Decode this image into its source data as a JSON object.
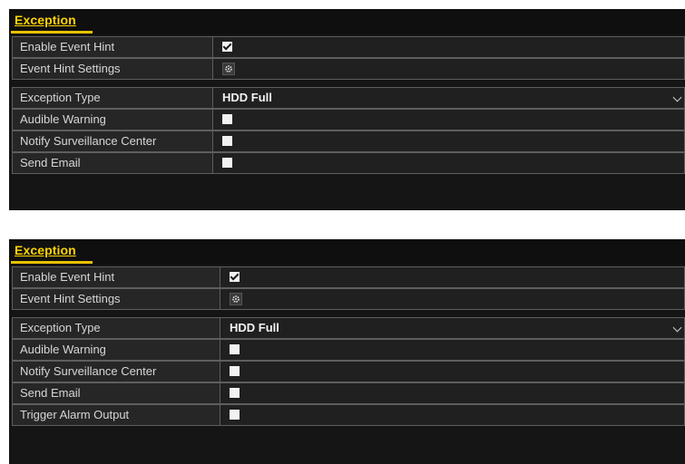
{
  "section": {
    "title": "Exception"
  },
  "panels": [
    {
      "rows_group1": [
        {
          "label": "Enable Event Hint",
          "type": "checkbox",
          "checked": true
        },
        {
          "label": "Event Hint Settings",
          "type": "gear"
        }
      ],
      "rows_group2": [
        {
          "label": "Exception Type",
          "type": "select",
          "value": "HDD Full"
        },
        {
          "label": "Audible Warning",
          "type": "checkbox",
          "checked": false
        },
        {
          "label": "Notify Surveillance Center",
          "type": "checkbox",
          "checked": false
        },
        {
          "label": "Send Email",
          "type": "checkbox",
          "checked": false
        }
      ]
    },
    {
      "rows_group1": [
        {
          "label": "Enable Event Hint",
          "type": "checkbox",
          "checked": true
        },
        {
          "label": "Event Hint Settings",
          "type": "gear"
        }
      ],
      "rows_group2": [
        {
          "label": "Exception Type",
          "type": "select",
          "value": "HDD Full"
        },
        {
          "label": "Audible Warning",
          "type": "checkbox",
          "checked": false
        },
        {
          "label": "Notify Surveillance Center",
          "type": "checkbox",
          "checked": false
        },
        {
          "label": "Send Email",
          "type": "checkbox",
          "checked": false
        },
        {
          "label": "Trigger Alarm Output",
          "type": "checkbox",
          "checked": false
        }
      ]
    }
  ],
  "icons": {
    "checkbox": "checkbox-icon",
    "gear": "gear-icon",
    "dropdown": "chevron-down-icon"
  },
  "colors": {
    "accent": "#ffd400",
    "panel_bg": "#151515",
    "border": "#5e5e5e"
  }
}
